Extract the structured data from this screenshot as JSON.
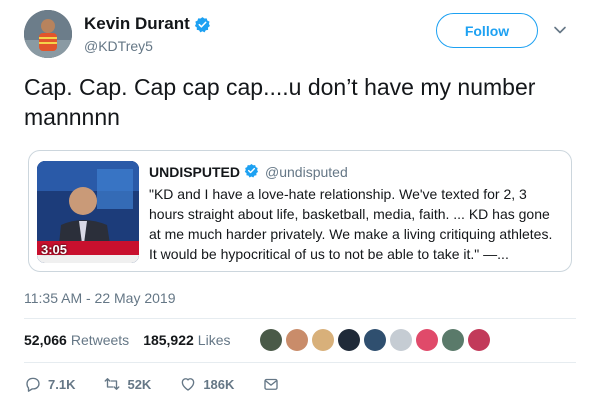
{
  "author": {
    "display_name": "Kevin Durant",
    "handle": "@KDTrey5"
  },
  "follow_label": "Follow",
  "tweet_text": "Cap. Cap. Cap cap cap....u don’t have my number mannnnn",
  "quote": {
    "display_name": "UNDISPUTED",
    "handle": "@undisputed",
    "text": "\"KD and I have a love-hate relationship. We've texted for 2, 3 hours straight about life, basketball, media, faith. ... KD has gone at me much harder privately. We make a living critiquing athletes. It would be hypocritical of us to not be able to take it.\" —...",
    "video_time": "3:05"
  },
  "timestamp": "11:35 AM - 22 May 2019",
  "stats": {
    "retweets_count": "52,066",
    "retweets_label": "Retweets",
    "likes_count": "185,922",
    "likes_label": "Likes"
  },
  "likers": [
    {
      "color": "#4a5a48"
    },
    {
      "color": "#c98c6a"
    },
    {
      "color": "#d8b07a"
    },
    {
      "color": "#1f2a38"
    },
    {
      "color": "#2f4f6f"
    },
    {
      "color": "#c5ccd3"
    },
    {
      "color": "#e04a6a"
    },
    {
      "color": "#5a7a6a"
    },
    {
      "color": "#c23a5a"
    }
  ],
  "actions": {
    "reply_count": "7.1K",
    "retweet_count": "52K",
    "like_count": "186K"
  },
  "colors": {
    "accent": "#1da1f2",
    "secondary_text": "#657786",
    "border": "#ccd6dd"
  },
  "icons": [
    "verified-badge-icon",
    "chevron-down-icon",
    "reply-icon",
    "retweet-icon",
    "like-icon",
    "direct-message-icon"
  ]
}
